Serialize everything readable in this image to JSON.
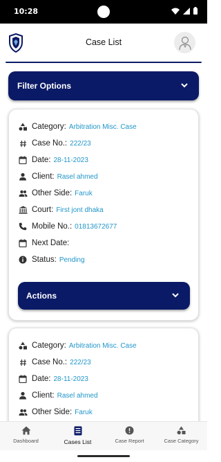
{
  "status": {
    "time": "10:28"
  },
  "appbar": {
    "title": "Case List"
  },
  "filter": {
    "label": "Filter Options"
  },
  "card_labels": {
    "category": "Category:",
    "case_no": "Case No.:",
    "date": "Date:",
    "client": "Client:",
    "other_side": "Other Side:",
    "court": "Court:",
    "mobile": "Mobile No.:",
    "next_date": "Next Date:",
    "status": "Status:",
    "actions": "Actions"
  },
  "cases": [
    {
      "category": "Arbitration Misc. Case",
      "case_no": "222/23",
      "date": "28-11-2023",
      "client": "Rasel ahmed",
      "other_side": "Faruk",
      "court": "First jont dhaka",
      "mobile": "01813672677",
      "next_date": "",
      "status": "Pending"
    },
    {
      "category": "Arbitration Misc. Case",
      "case_no": "222/23",
      "date": "28-11-2023",
      "client": "Rasel ahmed",
      "other_side": "Faruk"
    }
  ],
  "nav": {
    "dashboard": "Dashboard",
    "cases_list": "Cases List",
    "case_report": "Case Report",
    "case_category": "Case Category",
    "active": "cases_list"
  },
  "colors": {
    "primary": "#0b1a66",
    "value_text": "#2196c9"
  }
}
